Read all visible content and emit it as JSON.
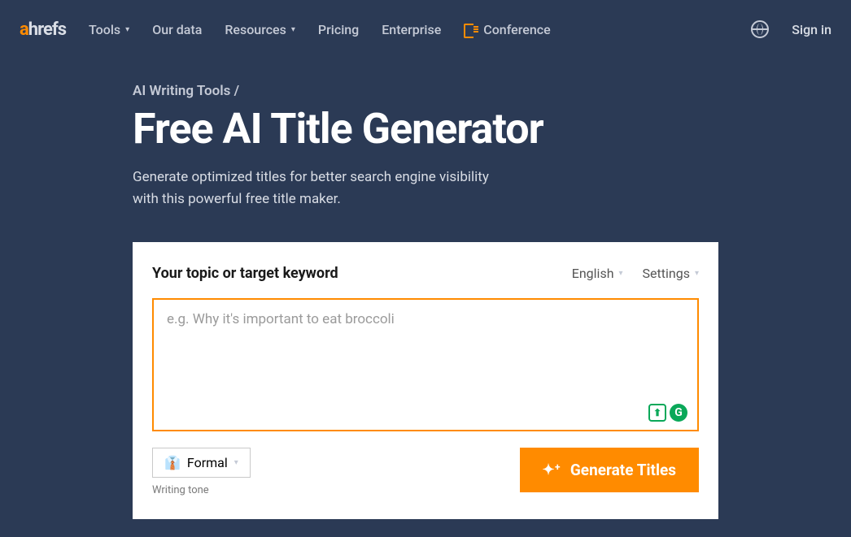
{
  "logo": {
    "a": "a",
    "rest": "hrefs"
  },
  "nav": {
    "tools": "Tools",
    "our_data": "Our data",
    "resources": "Resources",
    "pricing": "Pricing",
    "enterprise": "Enterprise",
    "conference": "Conference"
  },
  "sign_in": "Sign in",
  "breadcrumb": "AI Writing Tools /",
  "title": "Free AI Title Generator",
  "subtitle": "Generate optimized titles for better search engine visibility with this powerful free title maker.",
  "form": {
    "label": "Your topic or target keyword",
    "language": "English",
    "settings": "Settings",
    "placeholder": "e.g. Why it's important to eat broccoli",
    "tone_icon": "👔",
    "tone_value": "Formal",
    "tone_caption": "Writing tone",
    "generate": "Generate Titles"
  }
}
